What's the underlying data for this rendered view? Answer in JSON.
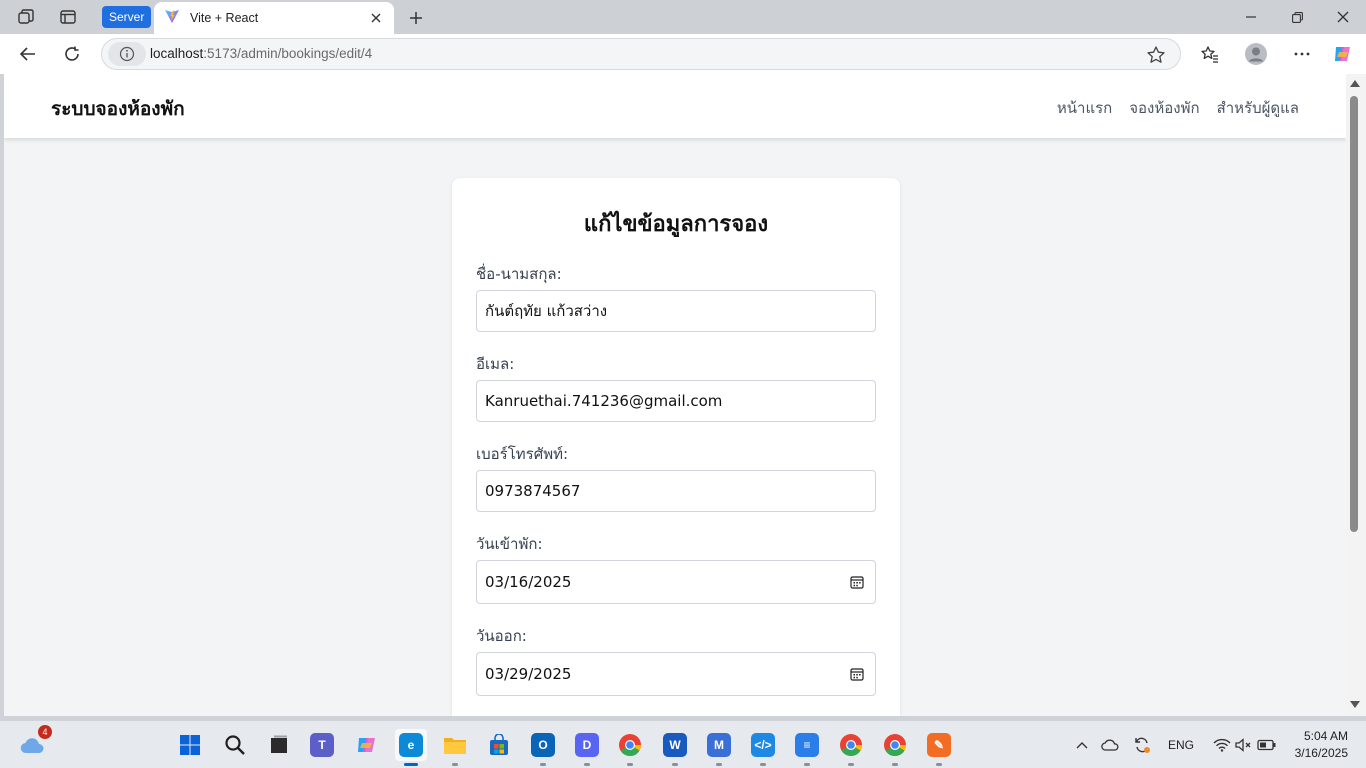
{
  "browser": {
    "server_label": "Server",
    "tab_title": "Vite + React",
    "url_host": "localhost",
    "url_path": ":5173/admin/bookings/edit/4"
  },
  "site": {
    "brand": "ระบบจองห้องพัก",
    "nav": [
      "หน้าแรก",
      "จองห้องพัก",
      "สำหรับผู้ดูแล"
    ]
  },
  "form": {
    "title": "แก้ไขข้อมูลการจอง",
    "fields": [
      {
        "label": "ชื่อ-นามสกุล:",
        "value": "กันต์ฤทัย แก้วสว่าง"
      },
      {
        "label": "อีเมล:",
        "value": "Kanruethai.741236@gmail.com"
      },
      {
        "label": "เบอร์โทรศัพท์:",
        "value": "0973874567"
      },
      {
        "label": "วันเข้าพัก:",
        "value": "03/16/2025"
      },
      {
        "label": "วันออก:",
        "value": "03/29/2025"
      }
    ]
  },
  "taskbar": {
    "weather_badge": "4",
    "language": "ENG",
    "time": "5:04 AM",
    "date": "3/16/2025",
    "apps": [
      {
        "name": "start",
        "color": "#0a64d8"
      },
      {
        "name": "search",
        "color": "#1f1f1f"
      },
      {
        "name": "task-view",
        "color": "#1f1f1f"
      },
      {
        "name": "teams",
        "color": "#5b5fc7"
      },
      {
        "name": "copilot",
        "color": "#c846c8"
      },
      {
        "name": "edge",
        "color": "#0c8ad8"
      },
      {
        "name": "file-explorer",
        "color": "#f2b01e"
      },
      {
        "name": "store",
        "color": "#1769c4"
      },
      {
        "name": "outlook",
        "color": "#0a64b8"
      },
      {
        "name": "discord",
        "color": "#5865f2"
      },
      {
        "name": "chrome",
        "color": "#2ea043"
      },
      {
        "name": "word",
        "color": "#185abd"
      },
      {
        "name": "m365",
        "color": "#3a6fd8"
      },
      {
        "name": "vscode",
        "color": "#1e88e5"
      },
      {
        "name": "notepad",
        "color": "#2b7de9"
      },
      {
        "name": "chrome-2",
        "color": "#2ea043"
      },
      {
        "name": "chrome-3",
        "color": "#2ea043"
      },
      {
        "name": "postman",
        "color": "#f36c23"
      }
    ]
  }
}
